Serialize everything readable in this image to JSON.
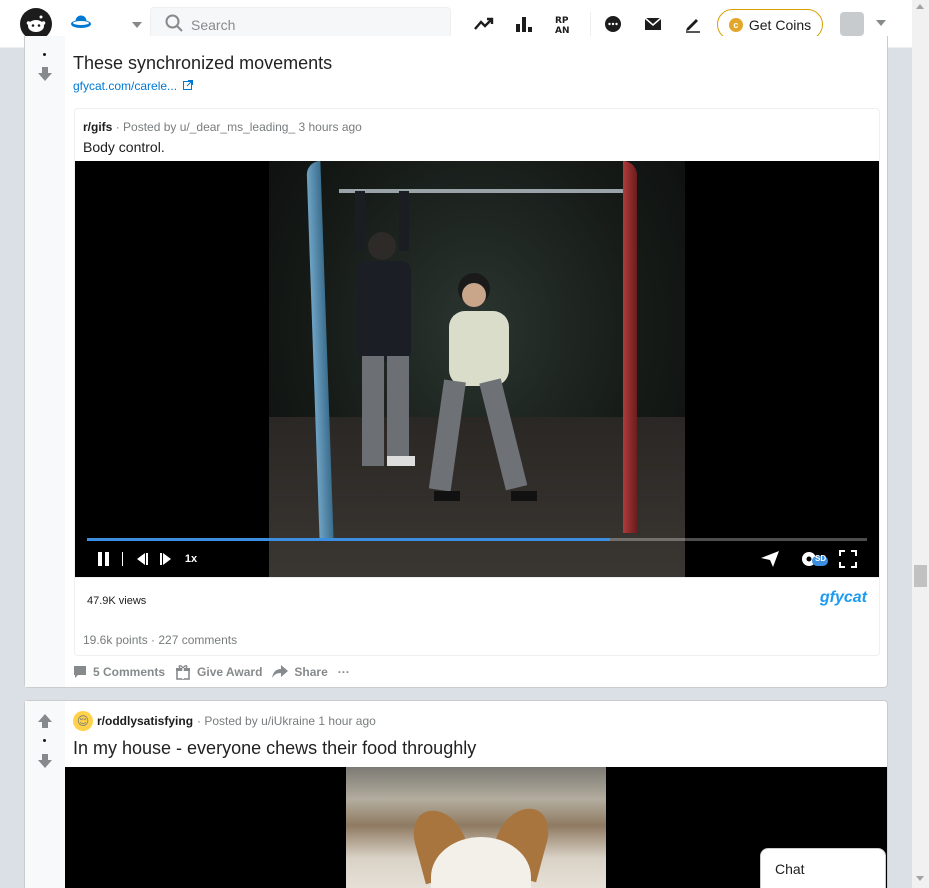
{
  "header": {
    "search_placeholder": "Search",
    "get_coins_label": "Get Coins",
    "icons": [
      "reddit-logo",
      "home-feed-icon",
      "popular-icon",
      "leaderboard-icon",
      "rpan-icon",
      "chat-icon",
      "mail-icon",
      "create-post-icon",
      "coin-icon",
      "avatar"
    ]
  },
  "post1": {
    "title": "These synchronized movements",
    "link_text": "gfycat.com/carele...",
    "embed": {
      "subreddit": "r/gifs",
      "posted_by": "· Posted by u/_dear_ms_leading_ 3 hours ago",
      "title": "Body control.",
      "views": "47.9K views",
      "brand": "gfycat",
      "stats": "19.6k points · 227 comments",
      "progress": 0.67,
      "speed_label": "1x",
      "quality_label": "SD"
    },
    "actions": {
      "comments": "5 Comments",
      "award": "Give Award",
      "share": "Share",
      "more": "···"
    }
  },
  "post2": {
    "subreddit": "r/oddlysatisfying",
    "posted_by": "· Posted by u/iUkraine 1 hour ago",
    "title": "In my house - everyone chews their food throughly"
  },
  "chat": {
    "label": "Chat"
  },
  "colors": {
    "accent_blue": "#0079d3",
    "progress_blue": "#3c8ee0",
    "coin_gold": "#e2a62b",
    "gfycat_blue": "#1d9bf0"
  }
}
